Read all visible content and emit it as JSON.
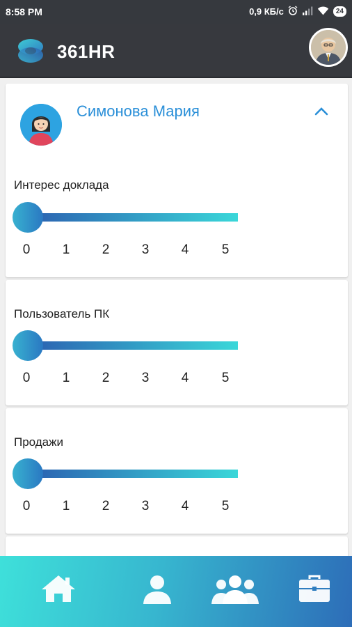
{
  "status_bar": {
    "time": "8:58 PM",
    "network_speed": "0,9 КБ/с",
    "battery": "24",
    "icons": [
      "alarm-icon",
      "signal-icon",
      "wifi-icon",
      "battery-icon"
    ]
  },
  "app_bar": {
    "title": "361HR",
    "logo": "app-logo-icon",
    "avatar": "user-avatar"
  },
  "person": {
    "name": "Симонова Мария",
    "expand_icon": "chevron-up-icon"
  },
  "ratings": [
    {
      "label": "Интерес доклада",
      "value": 0
    },
    {
      "label": "Пользователь ПК",
      "value": 0
    },
    {
      "label": "Продажи",
      "value": 0
    }
  ],
  "scale": [
    "0",
    "1",
    "2",
    "3",
    "4",
    "5"
  ],
  "bottom_nav": {
    "items": [
      "home-icon",
      "person-icon",
      "team-icon",
      "briefcase-icon"
    ]
  },
  "colors": {
    "app_bar": "#37393e",
    "accent_blue": "#2a8fd8",
    "gradient_start": "#3ee0da",
    "gradient_end": "#2d6db8"
  }
}
